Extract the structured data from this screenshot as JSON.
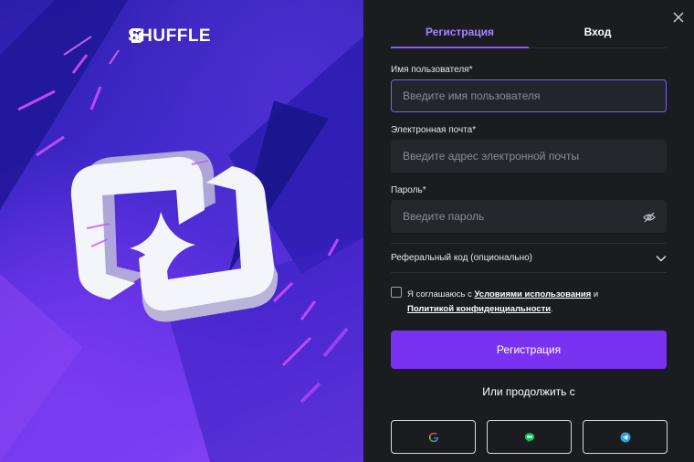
{
  "brand": {
    "name": "SHUFFLE"
  },
  "tabs": [
    {
      "label": "Регистрация",
      "active": true
    },
    {
      "label": "Вход",
      "active": false
    }
  ],
  "form": {
    "username": {
      "label": "Имя пользователя*",
      "placeholder": "Введите имя пользователя",
      "value": ""
    },
    "email": {
      "label": "Электронная почта*",
      "placeholder": "Введите адрес электронной почты",
      "value": ""
    },
    "password": {
      "label": "Пароль*",
      "placeholder": "Введите пароль",
      "value": ""
    },
    "referral_label": "Реферальный код (опционально)",
    "agree": {
      "prefix": "Я соглашаюсь с ",
      "terms_link": "Условиями использования",
      "middle": " и",
      "privacy_link": "Политикой конфиденциальности",
      "suffix": "."
    },
    "submit_label": "Регистрация",
    "or_label": "Или продолжить с"
  },
  "social": [
    {
      "icon": "google-icon"
    },
    {
      "icon": "line-icon"
    },
    {
      "icon": "telegram-icon"
    }
  ],
  "colors": {
    "accent": "#7a32f2",
    "tab_active": "#a585ff",
    "panel_bg": "#1a1c20",
    "input_bg": "#24272c"
  }
}
